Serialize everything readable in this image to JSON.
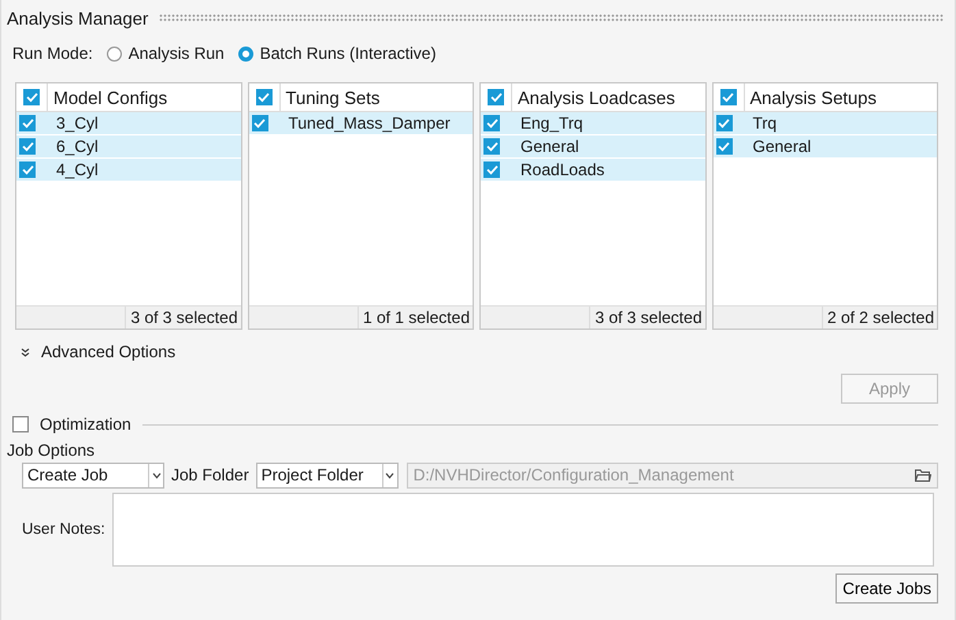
{
  "window": {
    "title": "Analysis Manager"
  },
  "run_mode": {
    "label": "Run Mode:",
    "options": [
      {
        "label": "Analysis Run",
        "selected": false
      },
      {
        "label": "Batch Runs (Interactive)",
        "selected": true
      }
    ]
  },
  "lists": [
    {
      "title": "Model Configs",
      "checked": true,
      "footer": "3 of 3 selected",
      "items": [
        {
          "label": "3_Cyl",
          "checked": true
        },
        {
          "label": "6_Cyl",
          "checked": true
        },
        {
          "label": "4_Cyl",
          "checked": true
        }
      ]
    },
    {
      "title": "Tuning Sets",
      "checked": true,
      "footer": "1 of 1 selected",
      "items": [
        {
          "label": "Tuned_Mass_Damper",
          "checked": true
        }
      ]
    },
    {
      "title": "Analysis Loadcases",
      "checked": true,
      "footer": "3 of 3 selected",
      "items": [
        {
          "label": "Eng_Trq",
          "checked": true
        },
        {
          "label": "General",
          "checked": true
        },
        {
          "label": "RoadLoads",
          "checked": true
        }
      ]
    },
    {
      "title": "Analysis Setups",
      "checked": true,
      "footer": "2 of 2 selected",
      "items": [
        {
          "label": "Trq",
          "checked": true
        },
        {
          "label": "General",
          "checked": true
        }
      ]
    }
  ],
  "advanced_options": {
    "label": "Advanced Options",
    "expanded": false
  },
  "apply_button": {
    "label": "Apply",
    "disabled": true
  },
  "optimization": {
    "label": "Optimization",
    "checked": false
  },
  "job_options": {
    "title": "Job Options",
    "job_type": "Create Job",
    "job_folder_label": "Job Folder",
    "job_folder": "Project Folder",
    "path": "D:/NVHDirector/Configuration_Management",
    "user_notes_label": "User Notes:"
  },
  "create_button": {
    "label": "Create Jobs",
    "disabled": false
  }
}
